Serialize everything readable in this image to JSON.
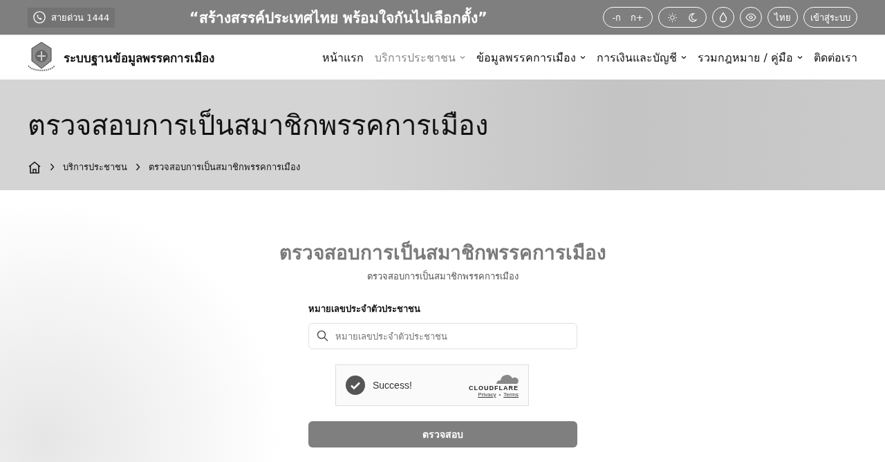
{
  "top_bar": {
    "hotline": "สายด่วน 1444",
    "slogan": "“สร้างสรรค์ประเทศไทย พร้อมใจกันไปเลือกตั้ง”",
    "font_size_buttons": [
      "-ก",
      "ก+"
    ],
    "language": "ไทย",
    "login": "เข้าสู่ระบบ"
  },
  "header": {
    "site_name": "ระบบฐานข้อมูลพรรคการเมือง",
    "nav": [
      {
        "label": "หน้าแรก",
        "selected": false,
        "dropdown": false
      },
      {
        "label": "บริการประชาชน",
        "selected": true,
        "dropdown": true
      },
      {
        "label": "ข้อมูลพรรคการเมือง",
        "selected": false,
        "dropdown": true
      },
      {
        "label": "การเงินและบัญชี",
        "selected": false,
        "dropdown": true
      },
      {
        "label": "รวมกฎหมาย / คู่มือ",
        "selected": false,
        "dropdown": true
      },
      {
        "label": "ติดต่อเรา",
        "selected": false,
        "dropdown": false
      }
    ]
  },
  "hero": {
    "title": "ตรวจสอบการเป็นสมาชิกพรรคการเมือง",
    "breadcrumb": [
      "บริการประชาชน",
      "ตรวจสอบการเป็นสมาชิกพรรคการเมือง"
    ]
  },
  "form": {
    "title": "ตรวจสอบการเป็นสมาชิกพรรคการเมือง",
    "subtitle": "ตรวจสอบการเป็นสมาชิกพรรคการเมือง",
    "field_label": "หมายเลขประจำตัวประชาชน",
    "placeholder": "หมายเลขประจำตัวประชาชน",
    "captcha": {
      "status": "Success!",
      "verified": true,
      "brand": "CLOUDFLARE",
      "links": [
        "Privacy",
        "Terms"
      ],
      "link_separator": "•"
    },
    "submit": "ตรวจสอบ"
  }
}
